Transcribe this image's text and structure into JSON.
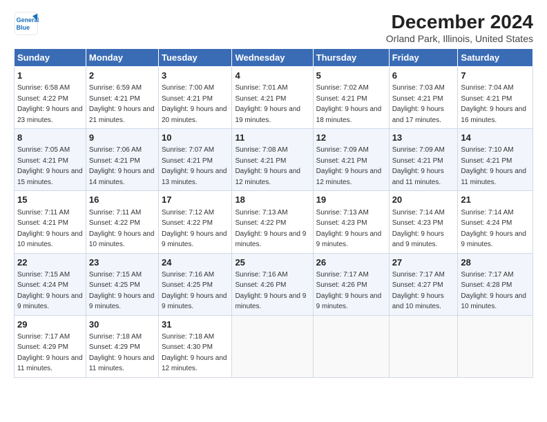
{
  "logo": {
    "line1": "General",
    "line2": "Blue"
  },
  "title": "December 2024",
  "subtitle": "Orland Park, Illinois, United States",
  "days_of_week": [
    "Sunday",
    "Monday",
    "Tuesday",
    "Wednesday",
    "Thursday",
    "Friday",
    "Saturday"
  ],
  "weeks": [
    [
      {
        "day": 1,
        "sunrise": "6:58 AM",
        "sunset": "4:22 PM",
        "daylight": "9 hours and 23 minutes."
      },
      {
        "day": 2,
        "sunrise": "6:59 AM",
        "sunset": "4:21 PM",
        "daylight": "9 hours and 21 minutes."
      },
      {
        "day": 3,
        "sunrise": "7:00 AM",
        "sunset": "4:21 PM",
        "daylight": "9 hours and 20 minutes."
      },
      {
        "day": 4,
        "sunrise": "7:01 AM",
        "sunset": "4:21 PM",
        "daylight": "9 hours and 19 minutes."
      },
      {
        "day": 5,
        "sunrise": "7:02 AM",
        "sunset": "4:21 PM",
        "daylight": "9 hours and 18 minutes."
      },
      {
        "day": 6,
        "sunrise": "7:03 AM",
        "sunset": "4:21 PM",
        "daylight": "9 hours and 17 minutes."
      },
      {
        "day": 7,
        "sunrise": "7:04 AM",
        "sunset": "4:21 PM",
        "daylight": "9 hours and 16 minutes."
      }
    ],
    [
      {
        "day": 8,
        "sunrise": "7:05 AM",
        "sunset": "4:21 PM",
        "daylight": "9 hours and 15 minutes."
      },
      {
        "day": 9,
        "sunrise": "7:06 AM",
        "sunset": "4:21 PM",
        "daylight": "9 hours and 14 minutes."
      },
      {
        "day": 10,
        "sunrise": "7:07 AM",
        "sunset": "4:21 PM",
        "daylight": "9 hours and 13 minutes."
      },
      {
        "day": 11,
        "sunrise": "7:08 AM",
        "sunset": "4:21 PM",
        "daylight": "9 hours and 12 minutes."
      },
      {
        "day": 12,
        "sunrise": "7:09 AM",
        "sunset": "4:21 PM",
        "daylight": "9 hours and 12 minutes."
      },
      {
        "day": 13,
        "sunrise": "7:09 AM",
        "sunset": "4:21 PM",
        "daylight": "9 hours and 11 minutes."
      },
      {
        "day": 14,
        "sunrise": "7:10 AM",
        "sunset": "4:21 PM",
        "daylight": "9 hours and 11 minutes."
      }
    ],
    [
      {
        "day": 15,
        "sunrise": "7:11 AM",
        "sunset": "4:21 PM",
        "daylight": "9 hours and 10 minutes."
      },
      {
        "day": 16,
        "sunrise": "7:11 AM",
        "sunset": "4:22 PM",
        "daylight": "9 hours and 10 minutes."
      },
      {
        "day": 17,
        "sunrise": "7:12 AM",
        "sunset": "4:22 PM",
        "daylight": "9 hours and 9 minutes."
      },
      {
        "day": 18,
        "sunrise": "7:13 AM",
        "sunset": "4:22 PM",
        "daylight": "9 hours and 9 minutes."
      },
      {
        "day": 19,
        "sunrise": "7:13 AM",
        "sunset": "4:23 PM",
        "daylight": "9 hours and 9 minutes."
      },
      {
        "day": 20,
        "sunrise": "7:14 AM",
        "sunset": "4:23 PM",
        "daylight": "9 hours and 9 minutes."
      },
      {
        "day": 21,
        "sunrise": "7:14 AM",
        "sunset": "4:24 PM",
        "daylight": "9 hours and 9 minutes."
      }
    ],
    [
      {
        "day": 22,
        "sunrise": "7:15 AM",
        "sunset": "4:24 PM",
        "daylight": "9 hours and 9 minutes."
      },
      {
        "day": 23,
        "sunrise": "7:15 AM",
        "sunset": "4:25 PM",
        "daylight": "9 hours and 9 minutes."
      },
      {
        "day": 24,
        "sunrise": "7:16 AM",
        "sunset": "4:25 PM",
        "daylight": "9 hours and 9 minutes."
      },
      {
        "day": 25,
        "sunrise": "7:16 AM",
        "sunset": "4:26 PM",
        "daylight": "9 hours and 9 minutes."
      },
      {
        "day": 26,
        "sunrise": "7:17 AM",
        "sunset": "4:26 PM",
        "daylight": "9 hours and 9 minutes."
      },
      {
        "day": 27,
        "sunrise": "7:17 AM",
        "sunset": "4:27 PM",
        "daylight": "9 hours and 10 minutes."
      },
      {
        "day": 28,
        "sunrise": "7:17 AM",
        "sunset": "4:28 PM",
        "daylight": "9 hours and 10 minutes."
      }
    ],
    [
      {
        "day": 29,
        "sunrise": "7:17 AM",
        "sunset": "4:29 PM",
        "daylight": "9 hours and 11 minutes."
      },
      {
        "day": 30,
        "sunrise": "7:18 AM",
        "sunset": "4:29 PM",
        "daylight": "9 hours and 11 minutes."
      },
      {
        "day": 31,
        "sunrise": "7:18 AM",
        "sunset": "4:30 PM",
        "daylight": "9 hours and 12 minutes."
      },
      null,
      null,
      null,
      null
    ]
  ],
  "labels": {
    "sunrise": "Sunrise:",
    "sunset": "Sunset:",
    "daylight": "Daylight:"
  }
}
